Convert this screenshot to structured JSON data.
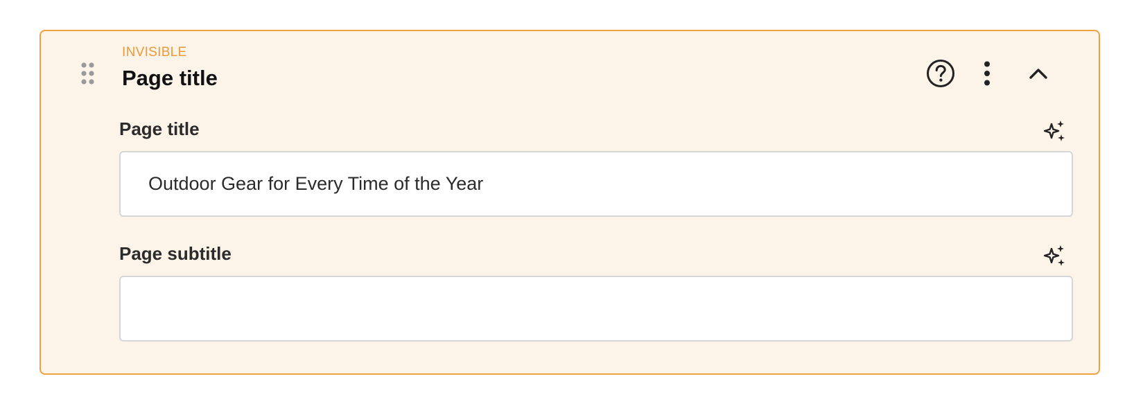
{
  "block": {
    "status": "INVISIBLE",
    "title": "Page title",
    "colors": {
      "accent": "#f0a040",
      "status_text": "#ec9a3a",
      "background": "#fcf3e9"
    },
    "icons": {
      "drag": "drag-handle-icon",
      "help": "help-circle-icon",
      "more": "more-vertical-icon",
      "collapse": "chevron-up-icon",
      "ai": "sparkles-icon"
    }
  },
  "fields": {
    "title": {
      "label": "Page title",
      "value": "Outdoor Gear for Every Time of the Year"
    },
    "subtitle": {
      "label": "Page subtitle",
      "value": ""
    }
  }
}
